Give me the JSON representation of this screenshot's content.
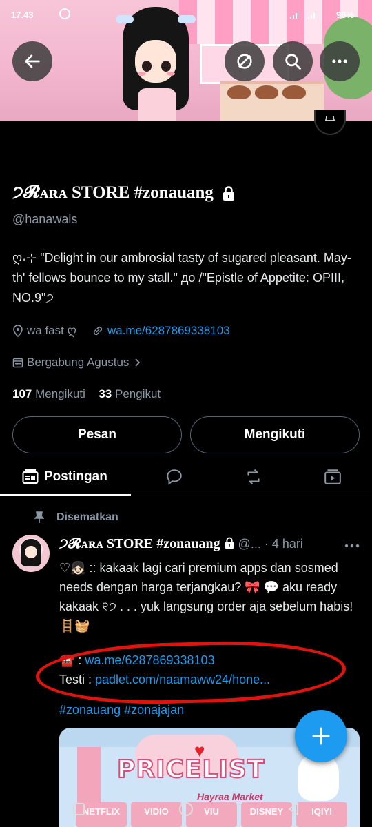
{
  "status_bar": {
    "time": "17.43",
    "right": "96%"
  },
  "banner": {
    "text_lines": [
      "",
      ""
    ]
  },
  "profile": {
    "name": "੭𝓡ᴀʀᴀ STORE #zonauang",
    "handle": "@hanawals",
    "bio": "ღ˖⊹ \"Delight in our ambrosial tasty of sugared pleasant. May-th' fellows bounce to my stall.\" до /\"Epistle of Appetite: OPIII, NO.9\"੭",
    "location": "wa fast ღ",
    "website": "wa.me/6287869338103",
    "joined": "Bergabung Agustus",
    "following_count": "107",
    "following_label": "Mengikuti",
    "followers_count": "33",
    "followers_label": "Pengikut"
  },
  "actions": {
    "message": "Pesan",
    "following": "Mengikuti"
  },
  "tabs": {
    "posts": "Postingan"
  },
  "post": {
    "pinned_label": "Disematkan",
    "author": "੭𝓡ᴀʀᴀ STORE #zonauang",
    "author_handle": "@...",
    "time": "· 4 hari",
    "line1": "♡👧🏻 :: kakaak lagi cari premium apps dan sosmed needs dengan harga terjangkau? 🎀 💬 aku ready kakaak ୧੭ . . . yuk langsung order aja sebelum habis! 🪜🧺",
    "phone_prefix": "☎️ : ",
    "phone_link": "wa.me/6287869338103",
    "testi_prefix": "Testi : ",
    "testi_link": "padlet.com/naamaww24/hone...",
    "hashtags": "#zonauang #zonajajan"
  },
  "media": {
    "title": "PRICELIST",
    "subtitle": "Hayraa Market",
    "columns": [
      "NETFLIX",
      "VIDIO",
      "VIU",
      "DISNEY",
      "IQIYI"
    ]
  },
  "colors": {
    "accent": "#1d9bf0",
    "annotation": "#e0140f"
  }
}
